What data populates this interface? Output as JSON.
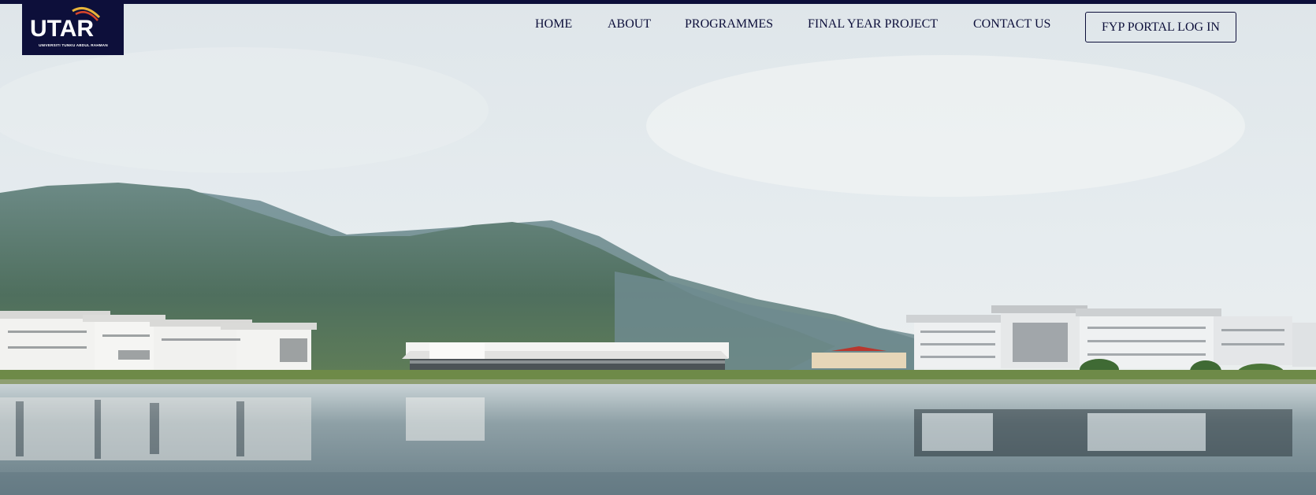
{
  "brand": {
    "logo_text": "UTAR",
    "logo_subtitle": "UNIVERSITI TUNKU ABDUL RAHMAN",
    "color_navy": "#0d0f3a",
    "swoosh_colors": [
      "#e8b43a",
      "#d6452b"
    ]
  },
  "nav": {
    "items": [
      {
        "label": "HOME"
      },
      {
        "label": "ABOUT"
      },
      {
        "label": "PROGRAMMES"
      },
      {
        "label": "FINAL YEAR PROJECT"
      },
      {
        "label": "CONTACT US"
      }
    ],
    "portal_button": "FYP PORTAL LOG IN"
  },
  "hero": {
    "scene": "campus-lake-mountain-photo"
  }
}
